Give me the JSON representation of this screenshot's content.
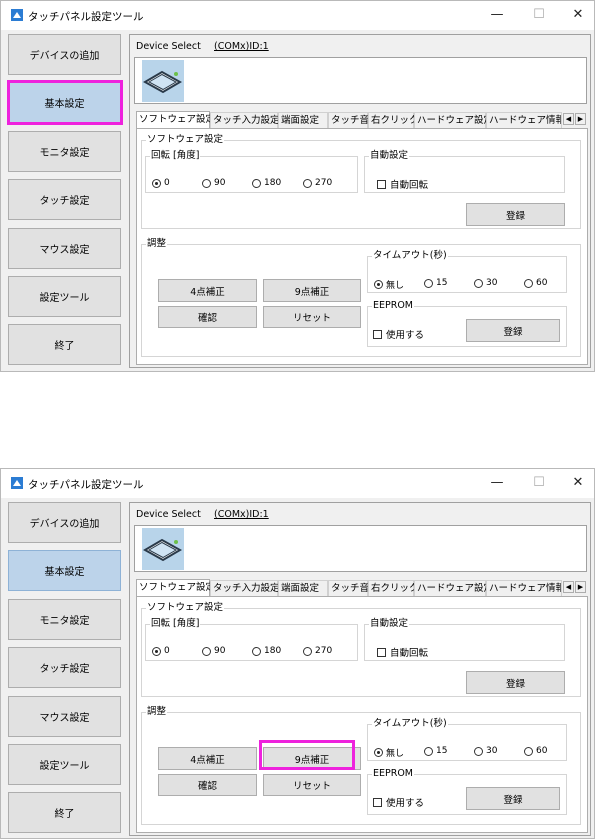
{
  "window": {
    "title": "タッチパネル設定ツール",
    "minimize": "—",
    "maximize": "☐",
    "close": "✕"
  },
  "sidebar": {
    "items": [
      {
        "label": "デバイスの追加"
      },
      {
        "label": "基本設定"
      },
      {
        "label": "モニタ設定"
      },
      {
        "label": "タッチ設定"
      },
      {
        "label": "マウス設定"
      },
      {
        "label": "設定ツール"
      },
      {
        "label": "終了"
      }
    ]
  },
  "device": {
    "select_label": "Device Select",
    "select_value": "(COMx)ID:1",
    "icon": "touch-panel-icon"
  },
  "tabs": [
    "ソフトウェア設定",
    "タッチ入力設定",
    "端面設定",
    "タッチ音",
    "右クリック",
    "ハードウェア設定",
    "ハードウェア情報"
  ],
  "tab_scroll": {
    "left": "◀",
    "right": "▶"
  },
  "software": {
    "group_label": "ソフトウェア設定",
    "rotation_label": "回転 [角度]",
    "rotations": [
      "0",
      "90",
      "180",
      "270"
    ],
    "rotation_selected": "0",
    "auto_group_label": "自動設定",
    "auto_rotate_label": "自動回転",
    "register_label": "登録"
  },
  "adjust": {
    "group_label": "調整",
    "four_point": "4点補正",
    "nine_point": "9点補正",
    "confirm": "確認",
    "reset": "リセット"
  },
  "timeout": {
    "group_label": "タイムアウト(秒)",
    "options": [
      "無し",
      "15",
      "30",
      "60"
    ],
    "selected": "無し"
  },
  "eeprom": {
    "group_label": "EEPROM",
    "use_label": "使用する",
    "register_label": "登録"
  },
  "colors": {
    "highlight": "#ee22dd",
    "active_item": "#bcd3ea"
  }
}
